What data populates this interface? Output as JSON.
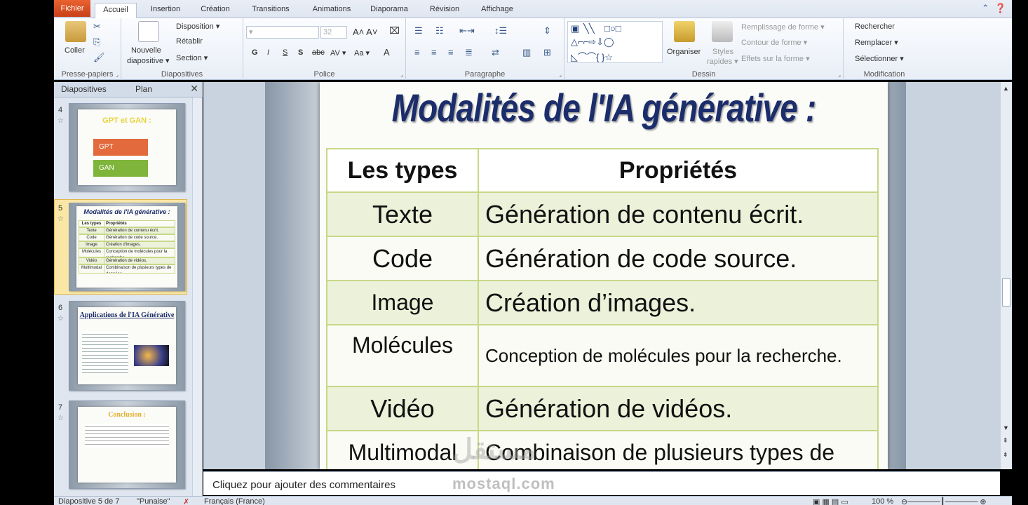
{
  "ribbon_tabs": [
    "Fichier",
    "Accueil",
    "Insertion",
    "Création",
    "Transitions",
    "Animations",
    "Diaporama",
    "Révision",
    "Affichage"
  ],
  "groups": {
    "clipboard": {
      "title": "Presse-papiers",
      "paste": "Coller"
    },
    "slides": {
      "title": "Diapositives",
      "new_slide_1": "Nouvelle",
      "new_slide_2": "diapositive ▾",
      "layout": "Disposition ▾",
      "reset": "Rétablir",
      "section": "Section ▾"
    },
    "font": {
      "title": "Police",
      "size": "32",
      "bold": "G",
      "italic": "I",
      "underline": "S",
      "shadow": "S",
      "strike": "abc",
      "spacing": "AV ▾",
      "case": "Aa ▾",
      "color": "A"
    },
    "paragraph": {
      "title": "Paragraphe"
    },
    "drawing": {
      "title": "Dessin",
      "arrange": "Organiser",
      "quick_styles_1": "Styles",
      "quick_styles_2": "rapides ▾",
      "shape_fill": "Remplissage de forme ▾",
      "shape_outline": "Contour de forme ▾",
      "shape_effects": "Effets sur la forme ▾"
    },
    "editing": {
      "title": "Modification",
      "find": "Rechercher",
      "replace": "Remplacer ▾",
      "select": "Sélectionner ▾"
    }
  },
  "left_panel": {
    "tabs": [
      "Diapositives",
      "Plan"
    ],
    "thumbnails": [
      {
        "number": "4",
        "title": "GPT et GAN :",
        "labels": [
          "GPT",
          "GAN"
        ]
      },
      {
        "number": "5",
        "title": "Modalités de l'IA générative :",
        "rows": [
          [
            "Les types",
            "Propriétés"
          ],
          [
            "Texte",
            "Génération de contenu écrit."
          ],
          [
            "Code",
            "Génération de code source."
          ],
          [
            "Image",
            "Création d'images."
          ],
          [
            "Molécules",
            "Conception de molécules pour la recherche."
          ],
          [
            "Vidéo",
            "Génération de vidéos."
          ],
          [
            "Multimodal",
            "Combinaison de plusieurs types de données."
          ]
        ]
      },
      {
        "number": "6",
        "title": "Applications de l'IA Générative"
      },
      {
        "number": "7",
        "title": "Conclusion :"
      }
    ]
  },
  "slide": {
    "title": "Modalités de l'IA générative :",
    "table": {
      "headers": [
        "Les types",
        "Propriétés"
      ],
      "rows": [
        [
          "Texte",
          "Génération de contenu écrit."
        ],
        [
          "Code",
          "Génération de code source."
        ],
        [
          "Image",
          "Création d’images."
        ],
        [
          "Molécules",
          "Conception de molécules pour  la recherche."
        ],
        [
          "Vidéo",
          "Génération de vidéos."
        ],
        [
          "Multimodal",
          "Combinaison de plusieurs types de"
        ]
      ]
    }
  },
  "notes_placeholder": "Cliquez pour ajouter des commentaires",
  "status": {
    "slide_info": "Diapositive 5 de 7",
    "theme": "\"Punaise\"",
    "language": "Français (France)",
    "zoom": "100 %"
  },
  "watermark": {
    "arabic": "مستقل",
    "latin": "mostaql.com"
  }
}
